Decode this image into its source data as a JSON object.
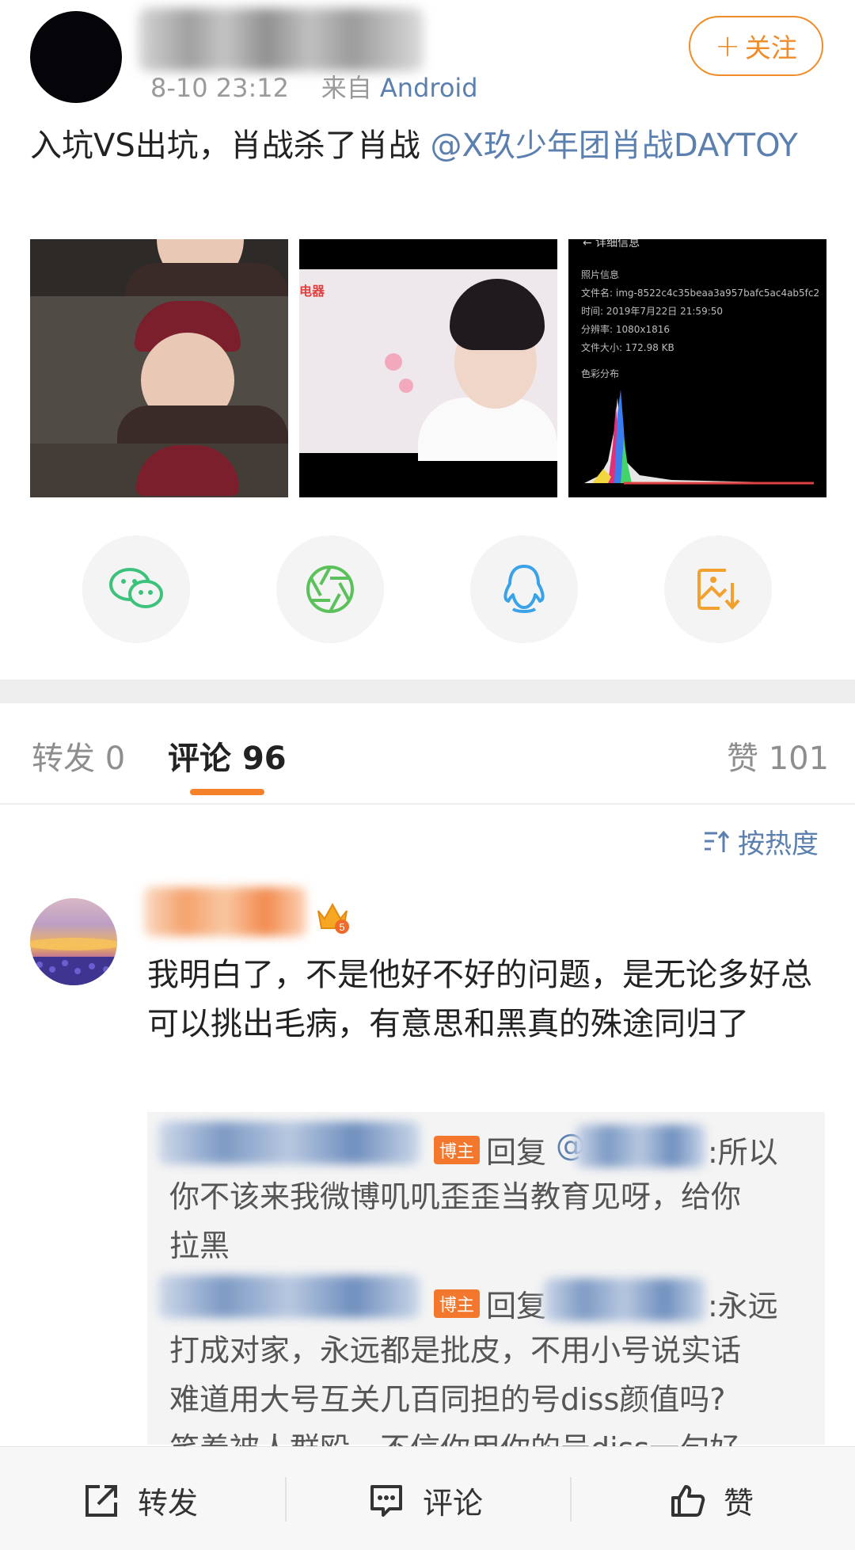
{
  "post": {
    "time": "8-10 23:12",
    "from_label": "来自",
    "source": "Android",
    "follow_label": "关注",
    "follow_plus": "+",
    "text_main": "入坑VS出坑，肖战杀了肖战 ",
    "text_mention": "@X玖少年团肖战DAYTOY"
  },
  "thumbs": {
    "t2_brand": "电器",
    "t3_title": "← 详细信息",
    "t3_info": [
      "照片信息",
      "文件名: img-8522c4c35beaa3a957bafc5ac4ab5fc2",
      "时间: 2019年7月22日 21:59:50",
      "分辨率: 1080x1816",
      "文件大小: 172.98 KB",
      "色彩分布"
    ]
  },
  "share": {
    "icons": [
      "wechat-icon",
      "moments-icon",
      "qq-icon",
      "save-image-icon"
    ],
    "colors": [
      "#3cc27a",
      "#5bc15b",
      "#3aa2e8",
      "#f2a12f"
    ]
  },
  "tabs": {
    "repost_label": "转发",
    "repost_count": "0",
    "comment_label": "评论",
    "comment_count": "96",
    "like_label": "赞",
    "like_count": "101"
  },
  "sort": {
    "label": "按热度"
  },
  "comment": {
    "level_badge": "5",
    "text": "我明白了，不是他好不好的问题，是无论多好总可以挑出毛病，有意思和黑真的殊途同归了",
    "replies": [
      {
        "badge": "博主",
        "reply_word": "回复",
        "at": "@",
        "first": ":所以",
        "lines": [
          "你不该来我微博叽叽歪歪当教育见呀，给你",
          "拉黑"
        ]
      },
      {
        "badge": "博主",
        "reply_word": "回复",
        "first": ":永远",
        "lines": [
          "打成对家，永远都是批皮，不用小号说实话",
          "难道用大号互关几百同担的号diss颜值吗?",
          "笑着被人群殴，不信你用你的号diss一句好"
        ]
      }
    ]
  },
  "bottom": {
    "repost": "转发",
    "comment": "评论",
    "like": "赞"
  },
  "accent": {
    "orange": "#f5822a",
    "link": "#5b7fae"
  }
}
